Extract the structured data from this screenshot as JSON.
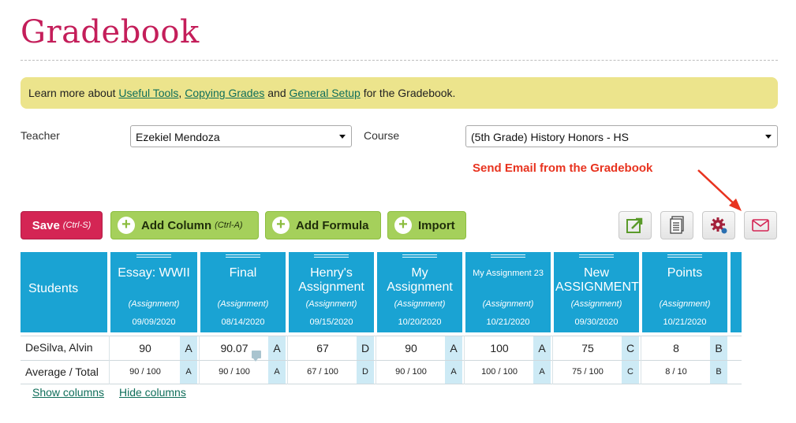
{
  "page": {
    "title": "Gradebook"
  },
  "info": {
    "prefix": "Learn more about ",
    "link1": "Useful Tools",
    "sep1": ", ",
    "link2": "Copying Grades",
    "sep2": " and ",
    "link3": "General Setup",
    "suffix": " for the Gradebook."
  },
  "filters": {
    "teacher_label": "Teacher",
    "teacher_value": "Ezekiel Mendoza",
    "course_label": "Course",
    "course_value": "(5th Grade) History Honors - HS"
  },
  "callout": "Send Email from the Gradebook",
  "toolbar": {
    "save": "Save",
    "save_shortcut": "(Ctrl-S)",
    "add_column": "Add Column",
    "add_column_shortcut": "(Ctrl-A)",
    "add_formula": "Add Formula",
    "import": "Import"
  },
  "colors": {
    "title": "#c41e5a",
    "header": "#1aa3d3",
    "save": "#d42554",
    "green": "#a5d05b",
    "callout": "#e8331f"
  },
  "grid": {
    "students_header": "Students",
    "columns": [
      {
        "name": "Essay: WWII",
        "type": "(Assignment)",
        "date": "09/09/2020"
      },
      {
        "name": "Final",
        "type": "(Assignment)",
        "date": "08/14/2020"
      },
      {
        "name": "Henry's Assignment",
        "type": "(Assignment)",
        "date": "09/15/2020"
      },
      {
        "name": "My Assignment",
        "type": "(Assignment)",
        "date": "10/20/2020"
      },
      {
        "name": "My Assignment 23",
        "type": "(Assignment)",
        "date": "10/21/2020"
      },
      {
        "name": "New ASSIGNMENT",
        "type": "(Assignment)",
        "date": "09/30/2020"
      },
      {
        "name": "Points",
        "type": "(Assignment)",
        "date": "10/21/2020"
      }
    ],
    "rows": [
      {
        "label": "DeSilva, Alvin",
        "cells": [
          {
            "score": "90",
            "grade": "A"
          },
          {
            "score": "90.07",
            "grade": "A"
          },
          {
            "score": "67",
            "grade": "D"
          },
          {
            "score": "90",
            "grade": "A"
          },
          {
            "score": "100",
            "grade": "A"
          },
          {
            "score": "75",
            "grade": "C"
          },
          {
            "score": "8",
            "grade": "B"
          }
        ]
      },
      {
        "label": "Average / Total",
        "cells": [
          {
            "score": "90 / 100",
            "grade": "A"
          },
          {
            "score": "90 / 100",
            "grade": "A"
          },
          {
            "score": "67 / 100",
            "grade": "D"
          },
          {
            "score": "90 / 100",
            "grade": "A"
          },
          {
            "score": "100 / 100",
            "grade": "A"
          },
          {
            "score": "75 / 100",
            "grade": "C"
          },
          {
            "score": "8 / 10",
            "grade": "B"
          }
        ]
      }
    ]
  },
  "links": {
    "show": "Show columns",
    "hide": "Hide columns"
  }
}
